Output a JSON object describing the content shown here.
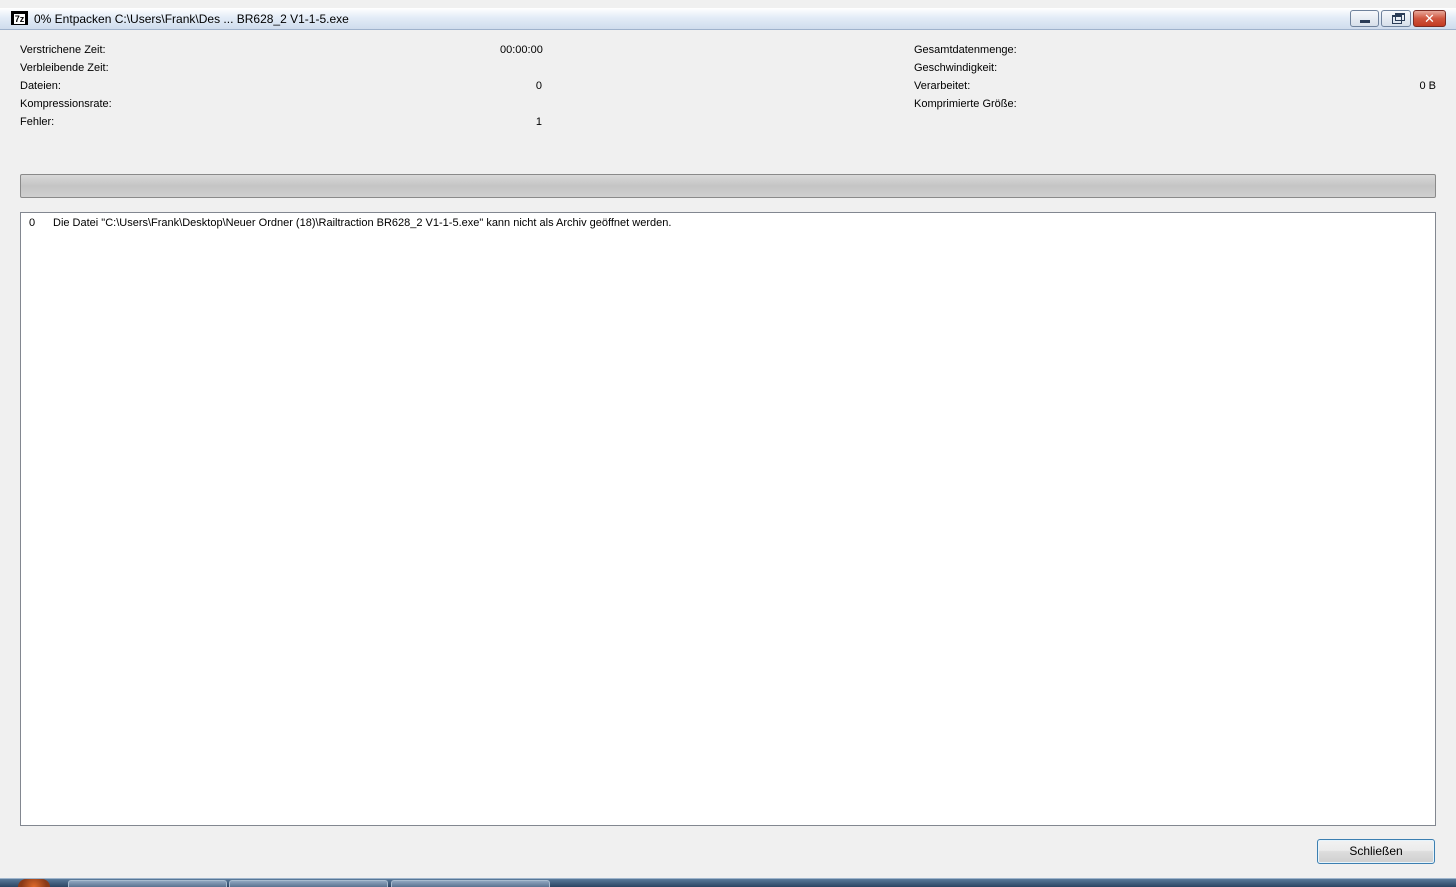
{
  "window": {
    "title": "0% Entpacken C:\\Users\\Frank\\Des ... BR628_2 V1-1-5.exe",
    "icon_label": "7z",
    "controls": [
      "minimize-icon",
      "restore-icon",
      "close-icon"
    ]
  },
  "stats_left": [
    {
      "label": "Verstrichene Zeit:",
      "value": "00:00:00"
    },
    {
      "label": "Verbleibende Zeit:",
      "value": ""
    },
    {
      "label": "Dateien:",
      "value": "0"
    },
    {
      "label": "Kompressionsrate:",
      "value": ""
    },
    {
      "label": "Fehler:",
      "value": "1"
    }
  ],
  "stats_right": [
    {
      "label": "Gesamtdatenmenge:",
      "value": ""
    },
    {
      "label": "Geschwindigkeit:",
      "value": ""
    },
    {
      "label": "Verarbeitet:",
      "value": "0 B"
    },
    {
      "label": "Komprimierte Größe:",
      "value": ""
    }
  ],
  "progress": {
    "percent": 0
  },
  "log": [
    {
      "index": "0",
      "message": "Die Datei \"C:\\Users\\Frank\\Desktop\\Neuer Ordner (18)\\Railtraction BR628_2 V1-1-5.exe\" kann nicht als Archiv geöffnet werden."
    }
  ],
  "buttons": {
    "close_label": "Schließen"
  },
  "colors": {
    "progress_fill": "#2fb34a",
    "focus_border": "#3c7fb1"
  }
}
